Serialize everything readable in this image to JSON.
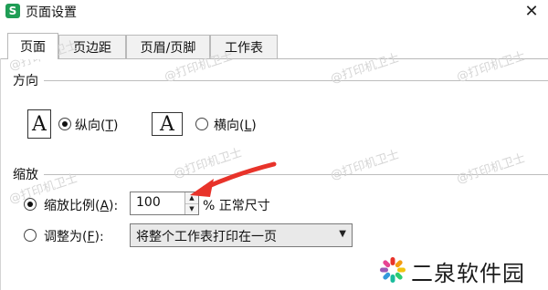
{
  "window": {
    "app_icon_text": "S",
    "title": "页面设置",
    "close_icon": "close-icon",
    "close_glyph": "✕"
  },
  "tabs": [
    {
      "label": "页面",
      "active": true
    },
    {
      "label": "页边距",
      "active": false
    },
    {
      "label": "页眉/页脚",
      "active": false
    },
    {
      "label": "工作表",
      "active": false
    }
  ],
  "orientation": {
    "heading": "方向",
    "portrait": {
      "glyph": "A",
      "label_prefix": "纵向(",
      "accel": "T",
      "label_suffix": ")",
      "selected": true
    },
    "landscape": {
      "glyph": "A",
      "label_prefix": "横向(",
      "accel": "L",
      "label_suffix": ")",
      "selected": false
    }
  },
  "scaling": {
    "heading": "缩放",
    "scale_option": {
      "label_prefix": "缩放比例(",
      "accel": "A",
      "label_suffix": "):",
      "selected": true
    },
    "scale_value": "100",
    "scale_suffix": "% 正常尺寸",
    "fit_option": {
      "label_prefix": "调整为(",
      "accel": "F",
      "label_suffix": "):",
      "selected": false
    },
    "fit_value": "将整个工作表打印在一页"
  },
  "watermark_text": "@打印机卫士",
  "brand": {
    "name": "二泉软件园"
  },
  "colors": {
    "arrow": "#e8332a",
    "app_icon": "#1f9d55",
    "brand_petals": [
      "#e8332a",
      "#f39c12",
      "#f1c40f",
      "#2ecc71",
      "#1abc9c",
      "#3498db",
      "#9b59b6",
      "#e84393"
    ]
  }
}
